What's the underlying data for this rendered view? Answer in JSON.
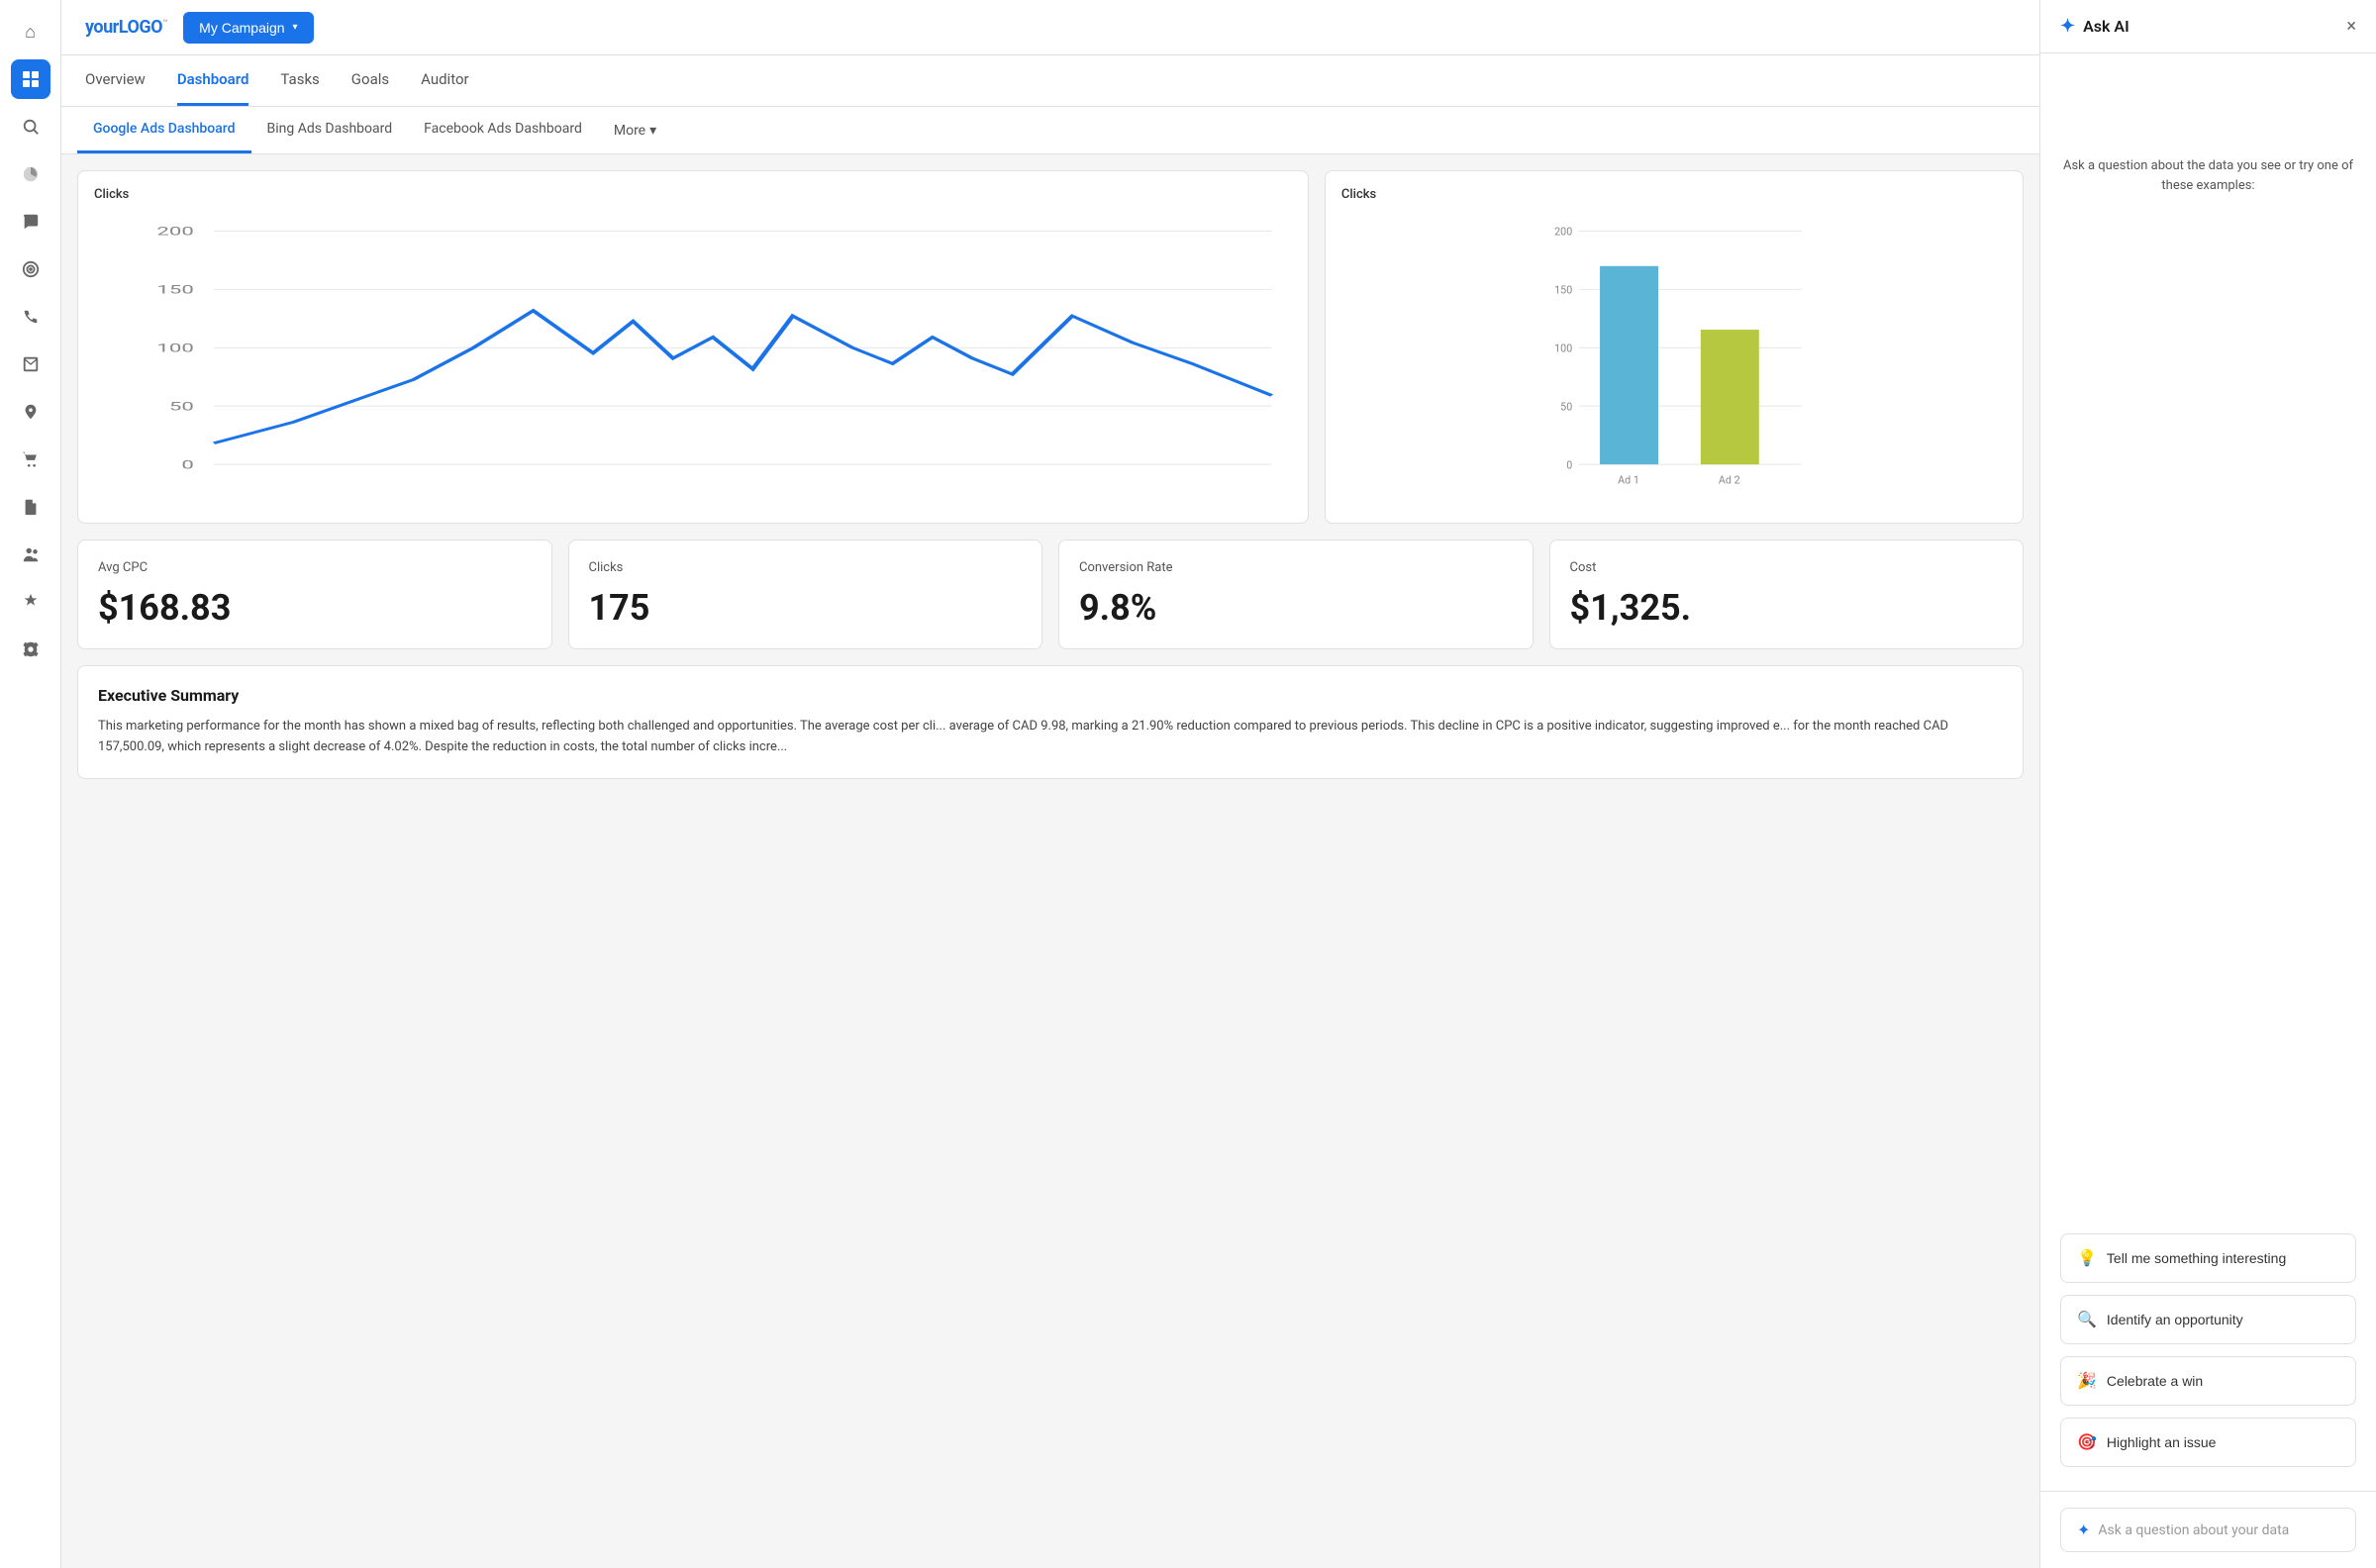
{
  "logo": {
    "text_your": "your",
    "text_logo": "LOGO",
    "trademark": "™"
  },
  "campaign_button": {
    "label": "My Campaign",
    "chevron": "▾"
  },
  "nav_tabs": [
    {
      "id": "overview",
      "label": "Overview",
      "active": false
    },
    {
      "id": "dashboard",
      "label": "Dashboard",
      "active": true
    },
    {
      "id": "tasks",
      "label": "Tasks",
      "active": false
    },
    {
      "id": "goals",
      "label": "Goals",
      "active": false
    },
    {
      "id": "auditor",
      "label": "Auditor",
      "active": false
    }
  ],
  "sub_tabs": [
    {
      "id": "google",
      "label": "Google Ads Dashboard",
      "active": true
    },
    {
      "id": "bing",
      "label": "Bing Ads Dashboard",
      "active": false
    },
    {
      "id": "facebook",
      "label": "Facebook Ads Dashboard",
      "active": false
    }
  ],
  "more_button": {
    "label": "More"
  },
  "charts": {
    "line_chart": {
      "title": "Clicks",
      "y_labels": [
        "200",
        "150",
        "100",
        "50",
        "0"
      ],
      "x_labels": []
    },
    "bar_chart": {
      "title": "Clicks",
      "y_labels": [
        "200",
        "150",
        "100",
        "50",
        "0"
      ],
      "bars": [
        {
          "label": "Ad 1",
          "value": 170,
          "color": "#5ab4d6"
        },
        {
          "label": "Ad 2",
          "value": 115,
          "color": "#b5c840"
        }
      ]
    }
  },
  "metrics": [
    {
      "label": "Avg CPC",
      "value": "$168.83"
    },
    {
      "label": "Clicks",
      "value": "175"
    },
    {
      "label": "Conversion Rate",
      "value": "9.8%"
    },
    {
      "label": "Cost",
      "value": "$1,325."
    }
  ],
  "executive_summary": {
    "title": "Executive Summary",
    "text": "This marketing performance for the month has shown a mixed bag of results, reflecting both challenged and opportunities. The average cost per cli... average of CAD 9.98, marking a 21.90% reduction compared to previous periods. This decline in CPC is a positive indicator, suggesting improved e... for the month reached CAD 157,500.09, which represents a slight decrease of 4.02%. Despite the reduction in costs, the total number of clicks incre..."
  },
  "ai_panel": {
    "title": "Ask AI",
    "close_label": "×",
    "description": "Ask a question about the data you see or try one of these examples:",
    "buttons": [
      {
        "id": "tell-me",
        "icon": "💡",
        "label": "Tell me something interesting"
      },
      {
        "id": "opportunity",
        "icon": "🔍",
        "label": "Identify an opportunity"
      },
      {
        "id": "celebrate",
        "icon": "🎉",
        "label": "Celebrate a win"
      },
      {
        "id": "highlight",
        "icon": "🎯",
        "label": "Highlight an issue"
      }
    ],
    "input_placeholder": "Ask a question about your data",
    "input_icon": "✦"
  },
  "sidebar_icons": [
    {
      "id": "home",
      "icon": "⌂",
      "active": false
    },
    {
      "id": "grid",
      "icon": "⊞",
      "active": true
    },
    {
      "id": "search",
      "icon": "🔍",
      "active": false
    },
    {
      "id": "chart",
      "icon": "◔",
      "active": false
    },
    {
      "id": "chat",
      "icon": "💬",
      "active": false
    },
    {
      "id": "target",
      "icon": "◎",
      "active": false
    },
    {
      "id": "phone",
      "icon": "☎",
      "active": false
    },
    {
      "id": "mail",
      "icon": "✉",
      "active": false
    },
    {
      "id": "location",
      "icon": "📍",
      "active": false
    },
    {
      "id": "cart",
      "icon": "🛒",
      "active": false
    },
    {
      "id": "doc",
      "icon": "📄",
      "active": false
    },
    {
      "id": "people",
      "icon": "👥",
      "active": false
    },
    {
      "id": "plugin",
      "icon": "⚡",
      "active": false
    },
    {
      "id": "settings",
      "icon": "⚙",
      "active": false
    }
  ]
}
